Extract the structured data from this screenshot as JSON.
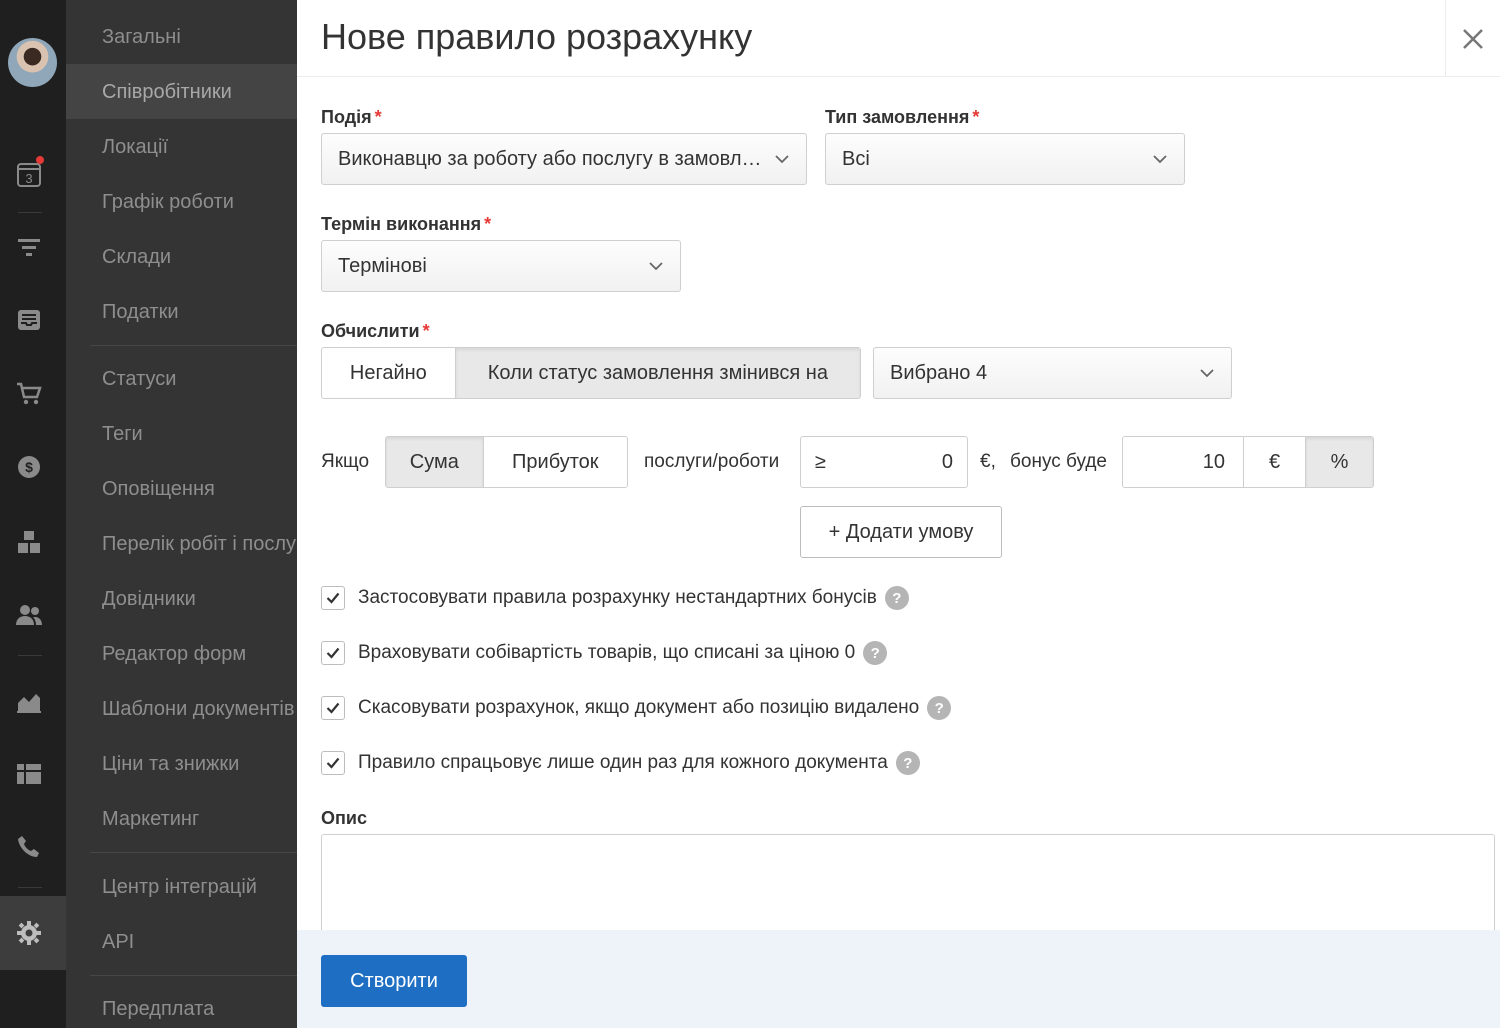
{
  "rail": {
    "calendar_day": "3",
    "icons": [
      "calendar-icon",
      "funnel-icon",
      "inbox-icon",
      "cart-icon",
      "dollar-icon",
      "boxes-icon",
      "users-icon",
      "chart-icon",
      "dashboard-icon",
      "phone-icon",
      "gear-icon"
    ]
  },
  "submenu": {
    "items": [
      {
        "label": "Загальні"
      },
      {
        "label": "Співробітники"
      },
      {
        "label": "Локації"
      },
      {
        "label": "Графік роботи"
      },
      {
        "label": "Склади"
      },
      {
        "label": "Податки"
      },
      {
        "label": "Статуси"
      },
      {
        "label": "Теги"
      },
      {
        "label": "Оповіщення"
      },
      {
        "label": "Перелік робіт і послуг"
      },
      {
        "label": "Довідники"
      },
      {
        "label": "Редактор форм"
      },
      {
        "label": "Шаблони документів"
      },
      {
        "label": "Ціни та знижки"
      },
      {
        "label": "Маркетинг"
      },
      {
        "label": "Центр інтеграцій"
      },
      {
        "label": "API"
      },
      {
        "label": "Передплата"
      }
    ]
  },
  "panel": {
    "title": "Нове правило розрахунку",
    "required_mark": "*",
    "event": {
      "label": "Подія",
      "value": "Виконавцю за роботу або послугу в замовленні"
    },
    "order_type": {
      "label": "Тип замовлення",
      "value": "Всі"
    },
    "term": {
      "label": "Термін виконання",
      "value": "Термінові"
    },
    "calculate": {
      "label": "Обчислити",
      "options": [
        "Негайно",
        "Коли статус замовлення змінився на"
      ],
      "statuses_value": "Вибрано 4"
    },
    "condition": {
      "if_label": "Якщо",
      "base_options": [
        "Сума",
        "Прибуток"
      ],
      "subject": "послуги/роботи",
      "operator": "≥",
      "amount": "0",
      "currency_suffix": "€,",
      "bonus_label": "бонус буде",
      "bonus_value": "10",
      "bonus_units": [
        "€",
        "%"
      ]
    },
    "add_condition": "+ Додати умову",
    "checkboxes": [
      {
        "label": "Застосовувати правила розрахунку нестандартних бонусів",
        "checked": true
      },
      {
        "label": "Враховувати собівартість товарів, що списані за ціною 0",
        "checked": true
      },
      {
        "label": "Скасовувати розрахунок, якщо документ або позицію видалено",
        "checked": true
      },
      {
        "label": "Правило спрацьовує лише один раз для кожного документа",
        "checked": true
      }
    ],
    "help_glyph": "?",
    "description_label": "Опис",
    "description_value": "",
    "create_button": "Створити"
  }
}
